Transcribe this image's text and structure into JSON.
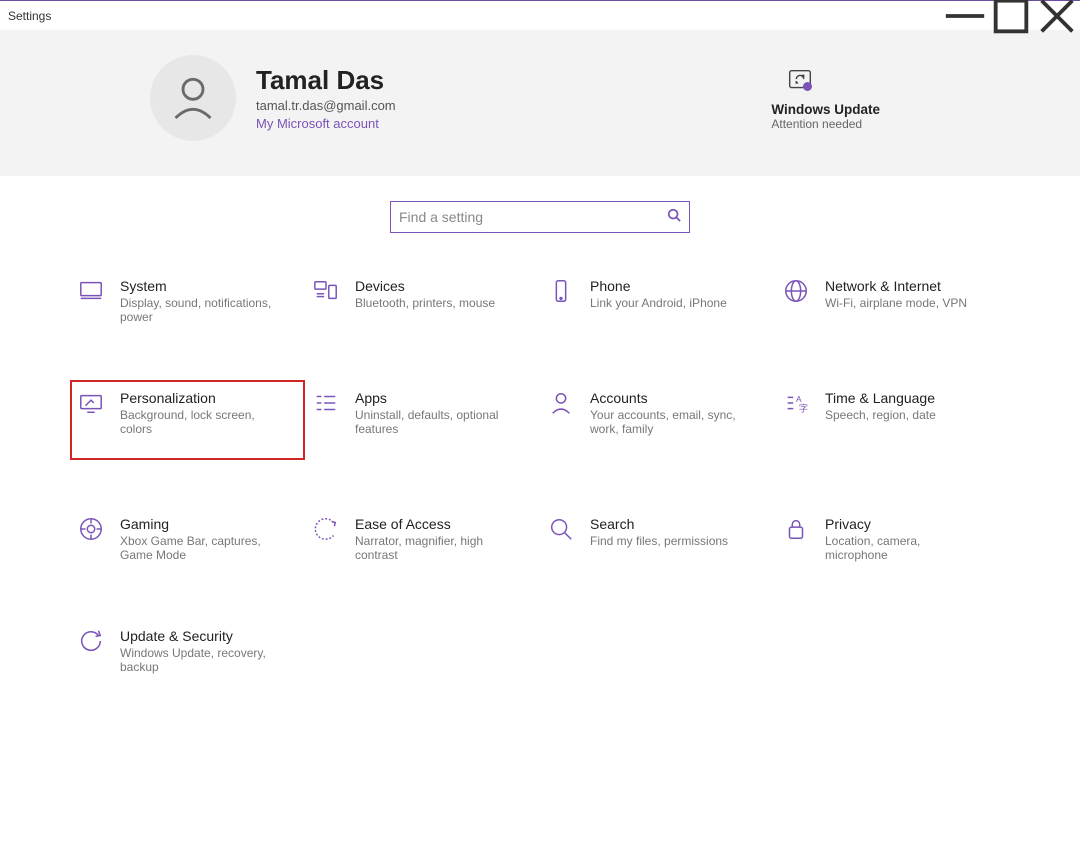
{
  "window": {
    "title": "Settings"
  },
  "user": {
    "name": "Tamal Das",
    "email": "tamal.tr.das@gmail.com",
    "account_link": "My Microsoft account"
  },
  "update_card": {
    "title": "Windows Update",
    "subtitle": "Attention needed"
  },
  "search": {
    "placeholder": "Find a setting"
  },
  "tiles": [
    {
      "title": "System",
      "subtitle": "Display, sound, notifications, power"
    },
    {
      "title": "Devices",
      "subtitle": "Bluetooth, printers, mouse"
    },
    {
      "title": "Phone",
      "subtitle": "Link your Android, iPhone"
    },
    {
      "title": "Network & Internet",
      "subtitle": "Wi-Fi, airplane mode, VPN"
    },
    {
      "title": "Personalization",
      "subtitle": "Background, lock screen, colors"
    },
    {
      "title": "Apps",
      "subtitle": "Uninstall, defaults, optional features"
    },
    {
      "title": "Accounts",
      "subtitle": "Your accounts, email, sync, work, family"
    },
    {
      "title": "Time & Language",
      "subtitle": "Speech, region, date"
    },
    {
      "title": "Gaming",
      "subtitle": "Xbox Game Bar, captures, Game Mode"
    },
    {
      "title": "Ease of Access",
      "subtitle": "Narrator, magnifier, high contrast"
    },
    {
      "title": "Search",
      "subtitle": "Find my files, permissions"
    },
    {
      "title": "Privacy",
      "subtitle": "Location, camera, microphone"
    },
    {
      "title": "Update & Security",
      "subtitle": "Windows Update, recovery, backup"
    }
  ],
  "highlighted_index": 4
}
